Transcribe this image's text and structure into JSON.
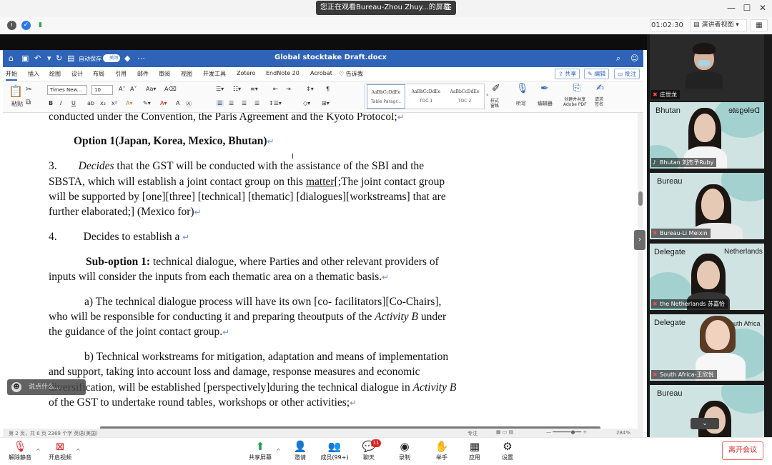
{
  "share_banner": {
    "text": "您正在观看Bureau-Zhou Zhuy...的屏幕",
    "menu_icon": "menu-icon"
  },
  "meeting_bar": {
    "timer": "01:02:30",
    "view_label": "演讲者视图",
    "grid_icon": "grid-icon"
  },
  "word": {
    "doc_title": "Global stocktake Draft.docx",
    "autosave_label": "自动保存",
    "toggle_label": "关闭",
    "tabs": [
      "开始",
      "插入",
      "绘图",
      "设计",
      "布局",
      "引用",
      "邮件",
      "审阅",
      "视图",
      "开发工具",
      "Zotero",
      "EndNote 20",
      "Acrobat"
    ],
    "tell_me": "告诉我",
    "share_btn": "共享",
    "edit_btn": "编辑",
    "comment_btn": "批注",
    "font_name": "Times New...",
    "font_size": "10",
    "paste_label": "粘贴",
    "styles": [
      {
        "sample": "AaBbCcDdEe",
        "name": "Table Paragr..."
      },
      {
        "sample": "AaBbCcDdEe",
        "name": "TOC 1"
      },
      {
        "sample": "AaBbCcDdEe",
        "name": "TOC 2"
      }
    ],
    "style_pane_label": "样式\n窗格",
    "dictate_label": "听写",
    "editor_label": "编辑器",
    "adobe_label": "创建并共享\nAdobe PDF",
    "sign_label": "请求\n签名",
    "status_text": "第 2 页，共 6 页    2369 个字    英语(美国)",
    "focus_label": "专注",
    "zoom_text": "284%"
  },
  "document": {
    "line1": "conducted under the Convention, the Paris Agreement and the Kyoto Protocol;",
    "option_heading": "Option 1(Japan, Korea, Mexico, Bhutan)",
    "p3_num": "3.",
    "p3_decides": "Decides",
    "p3_l1_rest": " that the GST will be conducted with the assistance of the SBI and the",
    "p3_l2a": "SBSTA, which will establish a joint contact group on this ",
    "p3_l2_matter": "matter",
    "p3_l2b": "[;The joint contact group",
    "p3_l3": "will be supported by [one][three] [technical] [thematic] [dialogues][workstreams] that are",
    "p3_l4": "further elaborated;] (Mexico for)",
    "p4_num": "4.",
    "p4_text": "Decides to establish a ",
    "sub_opt_label": "Sub-option 1:",
    "sub_opt_l1": " technical dialogue, where Parties and other relevant providers of",
    "sub_opt_l2": "inputs will consider the inputs from each thematic area on a thematic basis.",
    "a_l1": "a)   The technical dialogue process will have its own [co- facilitators][Co-Chairs],",
    "a_l2a": "who will be responsible for conducting it and preparing theoutputs of the ",
    "a_l2_em": "Activity B",
    "a_l2b": " under",
    "a_l3": "the guidance of the joint contact group.",
    "b_l1": "b) Technical workstreams for mitigation, adaptation and means of implementation",
    "b_l2": "and support, taking into account loss and damage, response measures and economic",
    "b_l3a": "diversification, will be established [perspectively]during the technical dialogue in ",
    "b_l3_em": "Activity B",
    "b_l4": "of the GST to undertake round tables, workshops or other activities;"
  },
  "chat_pill": "说点什么...",
  "participants": [
    {
      "name": "庄世龙",
      "bg_label": "",
      "bg_label2": ""
    },
    {
      "name": "Bhutan 刘杰予Ruby",
      "bg_label": "Bhutan",
      "bg_label2": "Delegate"
    },
    {
      "name": "Bureau-Li Meixin",
      "bg_label": "Bureau",
      "bg_label2": ""
    },
    {
      "name": "the Netherlands 苏嘉怡",
      "bg_label": "Delegate",
      "bg_label2": "Netherlands"
    },
    {
      "name": "South Africa-王欣悦",
      "bg_label": "Delegate",
      "bg_label2": "outh Africa"
    },
    {
      "name": "",
      "bg_label": "Bureau",
      "bg_label2": ""
    }
  ],
  "controls": {
    "unmute": "解除静音",
    "video": "开启视频",
    "share": "共享屏幕",
    "invite": "邀请",
    "members": "成员(99+)",
    "chat": "聊天",
    "chat_badge": "11",
    "record": "录制",
    "raise": "举手",
    "apps": "应用",
    "settings": "设置",
    "leave": "离开会议"
  },
  "colors": {
    "word_blue": "#2e63b8",
    "leave_red": "#d22222",
    "panel_dark": "#1a1a1a"
  }
}
